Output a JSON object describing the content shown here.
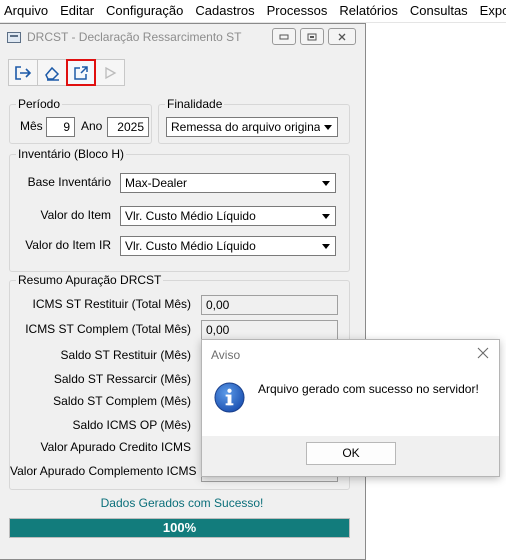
{
  "menu": [
    "Arquivo",
    "Editar",
    "Configuração",
    "Cadastros",
    "Processos",
    "Relatórios",
    "Consultas",
    "Exporta"
  ],
  "window": {
    "title": "DRCST - Declaração Ressarcimento ST",
    "toolbar_icons": [
      "exit-icon",
      "eraser-icon",
      "export-icon",
      "play-icon"
    ]
  },
  "periodo": {
    "legend": "Período",
    "mes_label": "Mês",
    "mes_value": "9",
    "ano_label": "Ano",
    "ano_value": "2025"
  },
  "finalidade": {
    "legend": "Finalidade",
    "value": "Remessa do arquivo original"
  },
  "inventario": {
    "legend": "Inventário (Bloco H)",
    "base_label": "Base Inventário",
    "base_value": "Max-Dealer",
    "valor_item_label": "Valor do Item",
    "valor_item_value": "Vlr. Custo Médio Líquido",
    "valor_item_ir_label": "Valor do Item IR",
    "valor_item_ir_value": "Vlr. Custo Médio Líquido"
  },
  "resumo": {
    "legend": "Resumo Apuração DRCST",
    "rows": [
      {
        "label": "ICMS ST Restituir (Total Mês)",
        "value": "0,00"
      },
      {
        "label": "ICMS ST Complem (Total Mês)",
        "value": "0,00"
      },
      {
        "label": "Saldo ST Restituir (Mês)",
        "value": ""
      },
      {
        "label": "Saldo ST Ressarcir (Mês)",
        "value": ""
      },
      {
        "label": "Saldo ST Complem (Mês)",
        "value": ""
      },
      {
        "label": "Saldo ICMS OP (Mês)",
        "value": ""
      },
      {
        "label": "Valor Apurado Credito ICMS",
        "value": ""
      },
      {
        "label": "Valor Apurado Complemento ICMS",
        "value": ""
      }
    ]
  },
  "status": {
    "text": "Dados Gerados com Sucesso!",
    "progress_label": "100%",
    "progress_fraction": 1.0
  },
  "dialog": {
    "title": "Aviso",
    "message": "Arquivo gerado com sucesso no servidor!",
    "ok_label": "OK"
  },
  "colors": {
    "progress_fill": "#127c7c",
    "status_text": "#0b6f7a",
    "highlight": "#e01010"
  }
}
